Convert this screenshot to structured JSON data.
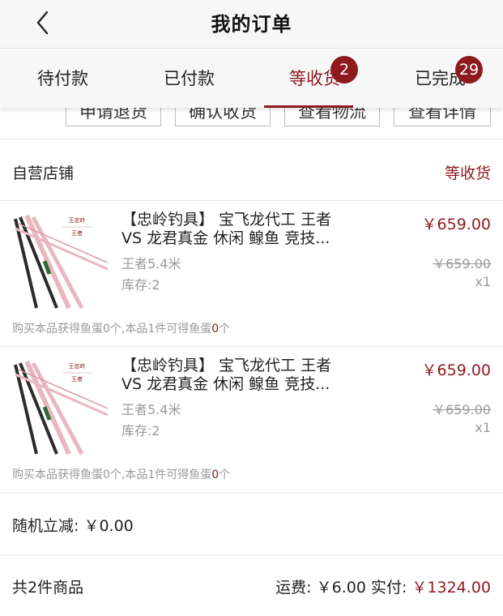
{
  "header": {
    "title": "我的订单",
    "back_icon": "chevron-left-icon"
  },
  "tabs": [
    {
      "label": "待付款"
    },
    {
      "label": "已付款"
    },
    {
      "label": "等收货",
      "badge": "2",
      "active": true
    },
    {
      "label": "已完成",
      "badge": "29"
    }
  ],
  "actions": [
    "申请退货",
    "确认收货",
    "查看物流",
    "查看详情"
  ],
  "order": {
    "shop_name": "自营店铺",
    "status": "等收货",
    "items": [
      {
        "thumb_caption_top": "王忠岭",
        "thumb_caption_mid": "王者",
        "name_line1": "【忠岭钓具】 宝飞龙代工 王者",
        "name_line2": "VS 龙君真金 休闲 鳈鱼 竞技...",
        "spec": "王者5.4米",
        "stock": "库存:2",
        "price": "￥659.00",
        "original_price": "￥659.00",
        "qty": "x1",
        "bonus_prefix": "购买本品获得鱼蛋0个,本品1件可得鱼蛋",
        "bonus_value": "0",
        "bonus_suffix": "个"
      },
      {
        "thumb_caption_top": "王忠岭",
        "thumb_caption_mid": "王者",
        "name_line1": "【忠岭钓具】 宝飞龙代工 王者",
        "name_line2": "VS 龙君真金 休闲 鳈鱼 竞技...",
        "spec": "王者5.4米",
        "stock": "库存:2",
        "price": "￥659.00",
        "original_price": "￥659.00",
        "qty": "x1",
        "bonus_prefix": "购买本品获得鱼蛋0个,本品1件可得鱼蛋",
        "bonus_value": "0",
        "bonus_suffix": "个"
      }
    ],
    "discount_label": "随机立减: ￥0.00",
    "total_count": "共2件商品",
    "shipping": "运费: ￥6.00",
    "paid_label": "实付: ",
    "paid_value": "￥1324.00"
  },
  "colors": {
    "accent": "#8e1a1f",
    "muted": "#999999",
    "rod_pink": "#e9b7c2",
    "rod_dark": "#2b2b2b"
  }
}
